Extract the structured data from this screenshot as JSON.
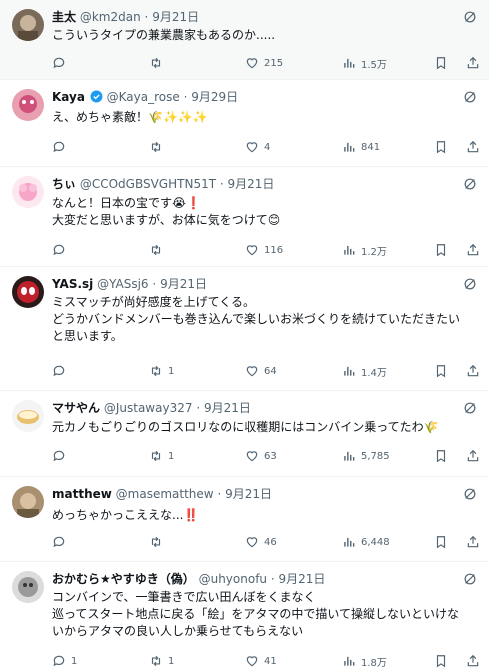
{
  "posts": [
    {
      "name": "圭太",
      "handle": "@km2dan",
      "date": "9月21日",
      "lines": [
        "こういうタイプの兼業農家もあるのか....."
      ],
      "replies": "",
      "retweets": "",
      "likes": "215",
      "views": "1.5万"
    },
    {
      "name": "Kaya",
      "verified": true,
      "handle": "@Kaya_rose",
      "date": "9月29日",
      "lines": [
        "え、めちゃ素敵！🌾✨✨✨"
      ],
      "replies": "",
      "retweets": "",
      "likes": "4",
      "views": "841"
    },
    {
      "name": "ちぃ",
      "handle": "@CCOdGBSVGHTN51T",
      "date": "9月21日",
      "lines": [
        "なんと！日本の宝です😭❗",
        "大変だと思いますが、お体に気をつけて😊"
      ],
      "replies": "",
      "retweets": "",
      "likes": "116",
      "views": "1.2万"
    },
    {
      "name": "YAS.sj",
      "handle": "@YASsj6",
      "date": "9月21日",
      "lines": [
        "ミスマッチが尚好感度を上げてくる。",
        "どうかバンドメンバーも巻き込んで楽しいお米づくりを続けていただきたい",
        "と思います。"
      ],
      "replies": "",
      "retweets": "1",
      "likes": "64",
      "views": "1.4万"
    },
    {
      "name": "マサやん",
      "handle": "@Justaway327",
      "date": "9月21日",
      "lines": [
        "元カノもごりごりのゴスロリなのに収穫期にはコンバイン乗ってたわ🌾"
      ],
      "replies": "",
      "retweets": "1",
      "likes": "63",
      "views": "5,785"
    },
    {
      "name": "matthew",
      "handle": "@masematthew",
      "date": "9月21日",
      "lines": [
        "めっちゃかっこええな...‼️"
      ],
      "replies": "",
      "retweets": "",
      "likes": "46",
      "views": "6,448"
    },
    {
      "name": "おかむら★やすゆき（偽）",
      "handle": "@uhyonofu",
      "date": "9月21日",
      "lines": [
        "コンバインで、一筆書きで広い田んぼをくまなく",
        "巡ってスタート地点に戻る「絵」をアタマの中で描いて操縦しないといけな",
        "いからアタマの良い人しか乗らせてもらえない"
      ],
      "replies": "1",
      "retweets": "1",
      "likes": "41",
      "views": "1.8万"
    }
  ],
  "colors": {
    "text": "#0f1419",
    "secondary": "#536471",
    "verified": "#1d9bf0",
    "divider": "#eff3f4",
    "highlight": "#f7f9f9"
  },
  "icons": {
    "reply": "reply-icon",
    "retweet": "retweet-icon",
    "like": "heart-icon",
    "views": "views-icon",
    "bookmark": "bookmark-icon",
    "share": "share-icon",
    "grok": "grok-icon",
    "verified": "verified-badge-icon"
  }
}
